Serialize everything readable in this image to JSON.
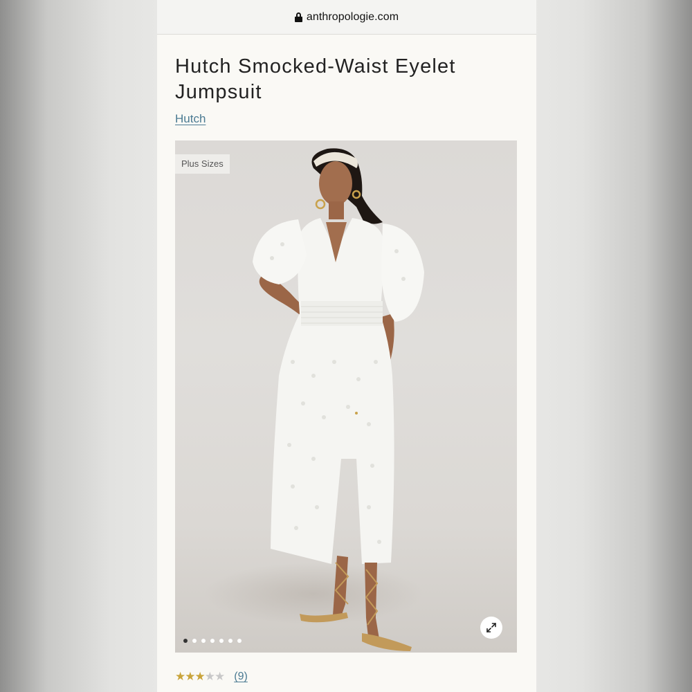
{
  "browser": {
    "url": "anthropologie.com"
  },
  "product": {
    "title": "Hutch Smocked-Waist Eyelet Jumpsuit",
    "brand": "Hutch"
  },
  "gallery": {
    "badge": "Plus Sizes",
    "image_count": 7,
    "active_index": 0,
    "image_description": "model in white eyelet puff-sleeve jumpsuit with smocked waist, tan lace-up sandals",
    "expand_icon": "expand-icon"
  },
  "rating": {
    "stars": 3,
    "max_stars": 5,
    "review_count": "(9)",
    "star_color": "#c9a43a"
  },
  "colors": {
    "link": "#4a7a92",
    "page_background": "#faf9f5"
  }
}
